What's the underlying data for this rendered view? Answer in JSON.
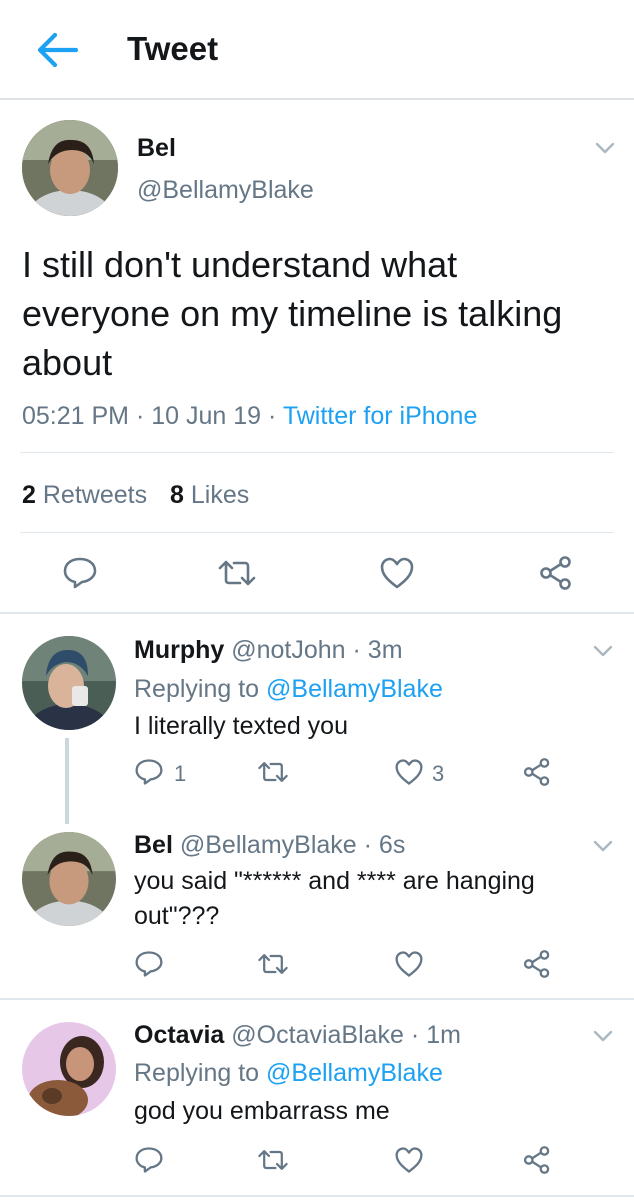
{
  "header": {
    "title": "Tweet"
  },
  "main_tweet": {
    "name": "Bel",
    "handle": "@BellamyBlake",
    "text_line1": "I still don't understand what",
    "text_line2": "everyone on my timeline is talking",
    "text_line3": "about",
    "time": "05:21 PM",
    "date": "10 Jun 19",
    "source": "Twitter for iPhone",
    "retweet_count": "2",
    "retweet_label": "Retweets",
    "like_count": "8",
    "like_label": "Likes"
  },
  "replies": [
    {
      "name": "Murphy",
      "handle": "@notJohn",
      "time": "3m",
      "replying_label": "Replying to",
      "replying_to": "@BellamyBlake",
      "text": "I literally texted you",
      "reply_count": "1",
      "like_count": "3"
    },
    {
      "name": "Bel",
      "handle": "@BellamyBlake",
      "time": "6s",
      "text_line1": "you said \"****** and **** are hanging",
      "text_line2": "out\"???"
    },
    {
      "name": "Octavia",
      "handle": "@OctaviaBlake",
      "time": "1m",
      "replying_label": "Replying to",
      "replying_to": "@BellamyBlake",
      "text": "god you embarrass me"
    }
  ],
  "colors": {
    "accent": "#1da1f2",
    "text": "#14171a",
    "secondary": "#657786",
    "icon": "#657786",
    "border": "#e1e8ed"
  },
  "icons": [
    "back-arrow-icon",
    "chevron-down-icon",
    "reply-icon",
    "retweet-icon",
    "like-icon",
    "share-icon"
  ]
}
